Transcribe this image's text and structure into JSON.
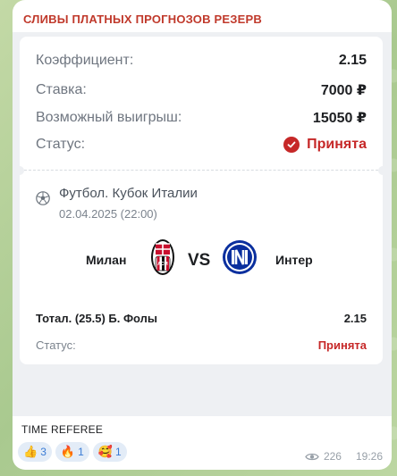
{
  "channel": {
    "name": "СЛИВЫ ПЛАТНЫХ ПРОГНОЗОВ РЕЗЕРВ"
  },
  "ticket": {
    "summary": [
      {
        "label": "Коэффициент:",
        "value": "2.15"
      },
      {
        "label": "Ставка:",
        "value": "7000 ₽"
      },
      {
        "label": "Возможный выигрыш:",
        "value": "15050 ₽"
      }
    ],
    "status_label": "Статус:",
    "status_value": "Принята",
    "event": {
      "league": "Футбол. Кубок Италии",
      "date": "02.04.2025 (22:00)",
      "home": "Милан",
      "vs": "VS",
      "away": "Интер"
    },
    "bet": {
      "name": "Тотал. (25.5) Б. Фолы",
      "odds": "2.15",
      "status_label": "Статус:",
      "status_value": "Принята"
    },
    "accent_color": "#c62828"
  },
  "message": {
    "caption": "TIME REFEREE",
    "reactions": [
      {
        "emoji": "👍",
        "icon": "thumbs-up-icon",
        "count": "3"
      },
      {
        "emoji": "🔥",
        "icon": "fire-icon",
        "count": "1"
      },
      {
        "emoji": "🥰",
        "icon": "hearts-face-icon",
        "count": "1"
      }
    ],
    "views": "226",
    "time": "19:26"
  }
}
